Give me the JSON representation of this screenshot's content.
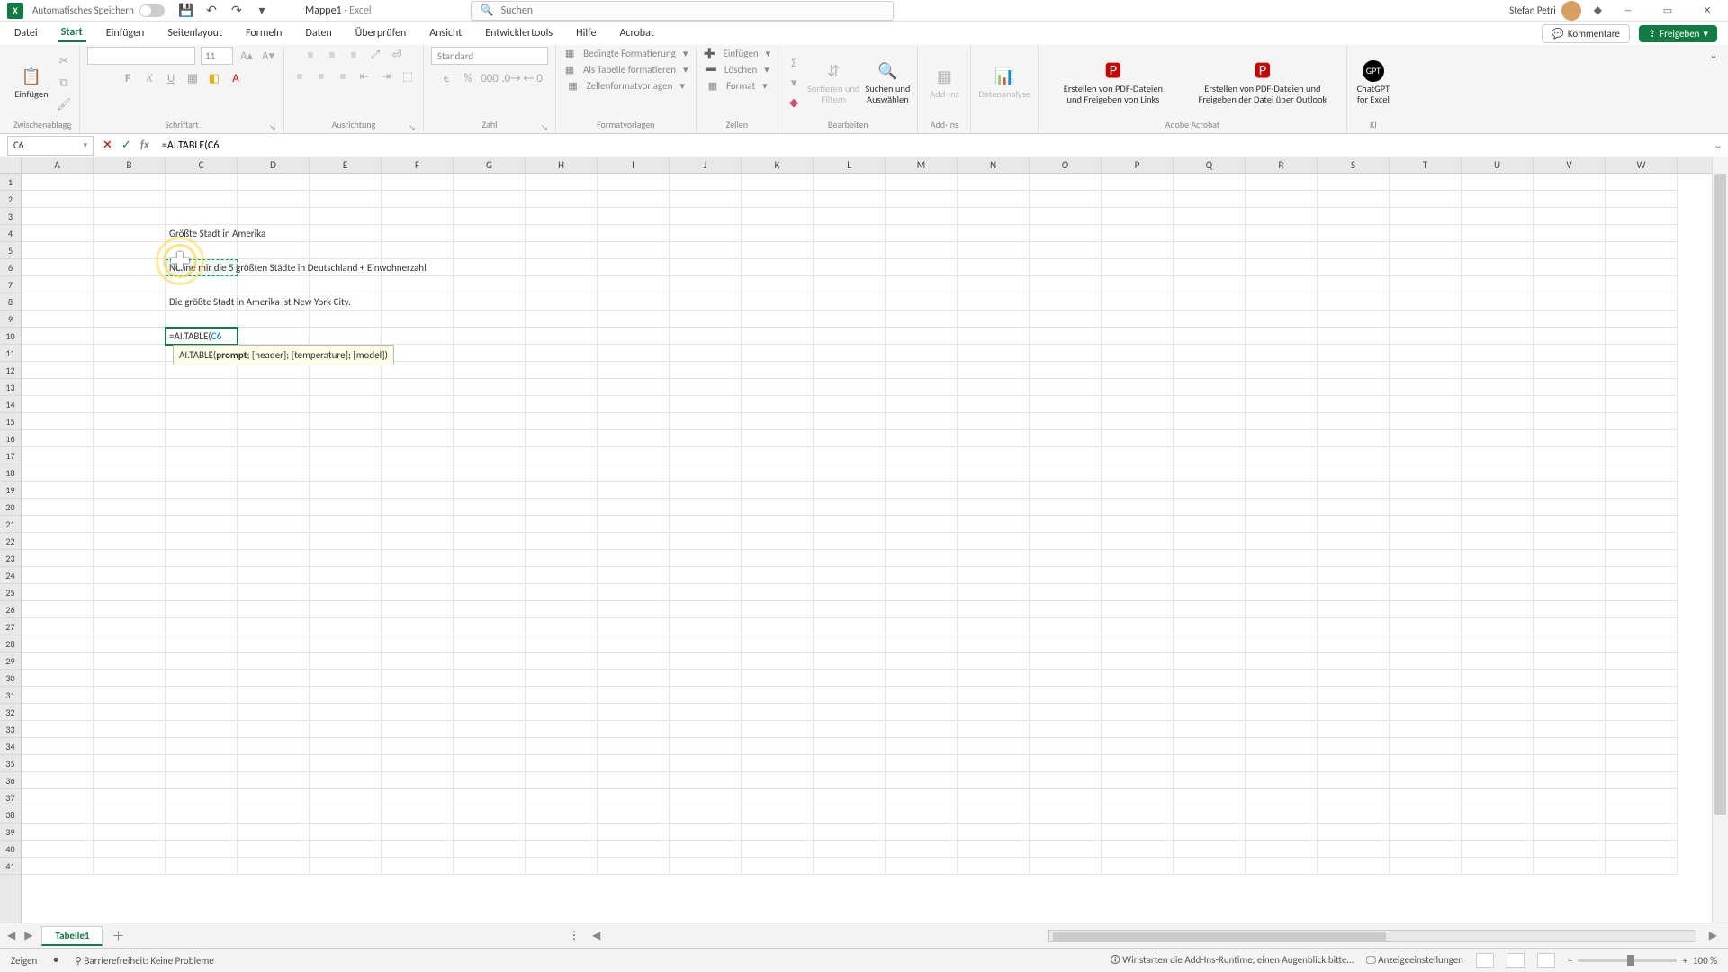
{
  "titlebar": {
    "app_icon_text": "X",
    "autosave_label": "Automatisches Speichern",
    "doc_name": "Mappe1",
    "app_name": "Excel",
    "search_placeholder": "Suchen",
    "user_name": "Stefan Petri"
  },
  "tabs": {
    "items": [
      "Datei",
      "Start",
      "Einfügen",
      "Seitenlayout",
      "Formeln",
      "Daten",
      "Überprüfen",
      "Ansicht",
      "Entwicklertools",
      "Hilfe",
      "Acrobat"
    ],
    "comments": "Kommentare",
    "share": "Freigeben"
  },
  "ribbon": {
    "clipboard": {
      "paste": "Einfügen",
      "label": "Zwischenablage"
    },
    "font": {
      "label": "Schriftart",
      "font_name": "",
      "font_size": "11"
    },
    "align": {
      "label": "Ausrichtung"
    },
    "number": {
      "label": "Zahl",
      "format": "Standard"
    },
    "styles": {
      "label": "Formatvorlagen",
      "cond": "Bedingte Formatierung",
      "table": "Als Tabelle formatieren",
      "cell": "Zellenformatvorlagen"
    },
    "cells": {
      "label": "Zellen",
      "insert": "Einfügen",
      "delete": "Löschen",
      "format": "Format"
    },
    "editing": {
      "label": "Bearbeiten",
      "sort": "Sortieren und\nFiltern",
      "find": "Suchen und\nAuswählen"
    },
    "addins": {
      "label": "Add-Ins",
      "btn": "Add-Ins"
    },
    "analysis": {
      "btn": "Datenanalyse"
    },
    "adobe": {
      "label": "Adobe Acrobat",
      "pdf1": "Erstellen von PDF-Dateien\nund Freigeben von Links",
      "pdf2": "Erstellen von PDF-Dateien und\nFreigeben der Datei über Outlook"
    },
    "ai": {
      "label": "KI",
      "btn": "ChatGPT\nfor Excel"
    }
  },
  "formula_bar": {
    "name_box": "C6",
    "formula": "=AI.TABLE(C6"
  },
  "columns": [
    "A",
    "B",
    "C",
    "D",
    "E",
    "F",
    "G",
    "H",
    "I",
    "J",
    "K",
    "L",
    "M",
    "N",
    "O",
    "P",
    "Q",
    "R",
    "S",
    "T",
    "U",
    "V",
    "W"
  ],
  "grid": {
    "c4": "Größte Stadt in Amerika",
    "c6": "Nenne mir die 5 größten Städte in Deutschland + Einwohnerzahl",
    "c8": "Die größte Stadt in Amerika ist New York City.",
    "c10_prefix": "=AI.TABLE(",
    "c10_ref": "C6",
    "tooltip_fn": "AI.TABLE(",
    "tooltip_prompt": "prompt",
    "tooltip_rest": "; [header]; [temperature]; [model])"
  },
  "sheettabs": {
    "tab1": "Tabelle1"
  },
  "status": {
    "mode": "Zeigen",
    "access": "Barrierefreiheit: Keine Probleme",
    "runtime": "Wir starten die Add-Ins-Runtime, einen Augenblick bitte…",
    "display": "Anzeigeeinstellungen",
    "zoom": "100 %"
  }
}
